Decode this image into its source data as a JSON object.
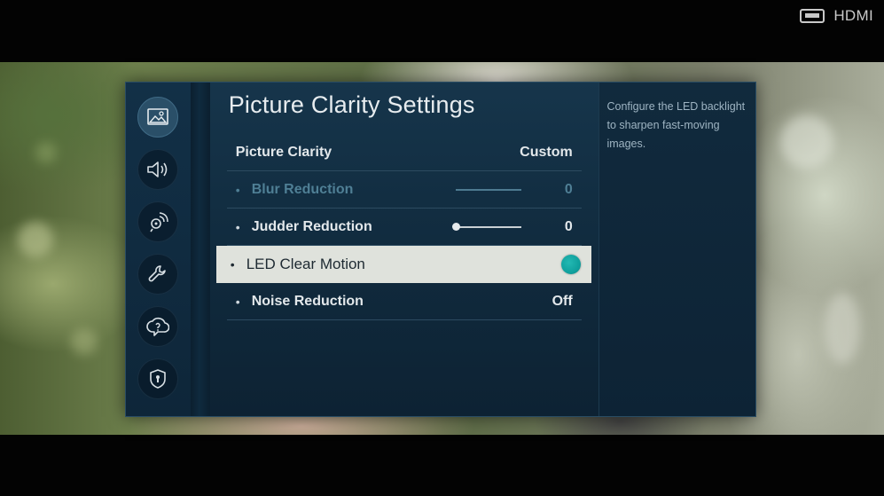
{
  "input_source": {
    "label": "HDMI",
    "icon": "hdmi-port-icon"
  },
  "sidebar": {
    "items": [
      {
        "icon": "picture-icon",
        "active": true
      },
      {
        "icon": "sound-icon",
        "active": false
      },
      {
        "icon": "broadcasting-icon",
        "active": false
      },
      {
        "icon": "general-wrench-icon",
        "active": false
      },
      {
        "icon": "support-icon",
        "active": false
      },
      {
        "icon": "privacy-shield-icon",
        "active": false
      }
    ]
  },
  "page": {
    "title": "Picture Clarity Settings"
  },
  "settings": {
    "picture_clarity": {
      "label": "Picture Clarity",
      "value": "Custom"
    },
    "blur_reduction": {
      "bullet": "•",
      "label": "Blur Reduction",
      "value": "0",
      "level": 0
    },
    "judder_reduction": {
      "bullet": "•",
      "label": "Judder Reduction",
      "value": "0",
      "level": 0
    },
    "led_clear_motion": {
      "bullet": "•",
      "label": "LED Clear Motion",
      "enabled": true
    },
    "noise_reduction": {
      "bullet": "•",
      "label": "Noise Reduction",
      "value": "Off"
    }
  },
  "help": {
    "text": "Configure the LED backlight to sharpen fast-moving images."
  },
  "colors": {
    "toggle_on": "#0e9f9c",
    "selected_row": "#dfe2dc",
    "panel": "#16354b"
  }
}
